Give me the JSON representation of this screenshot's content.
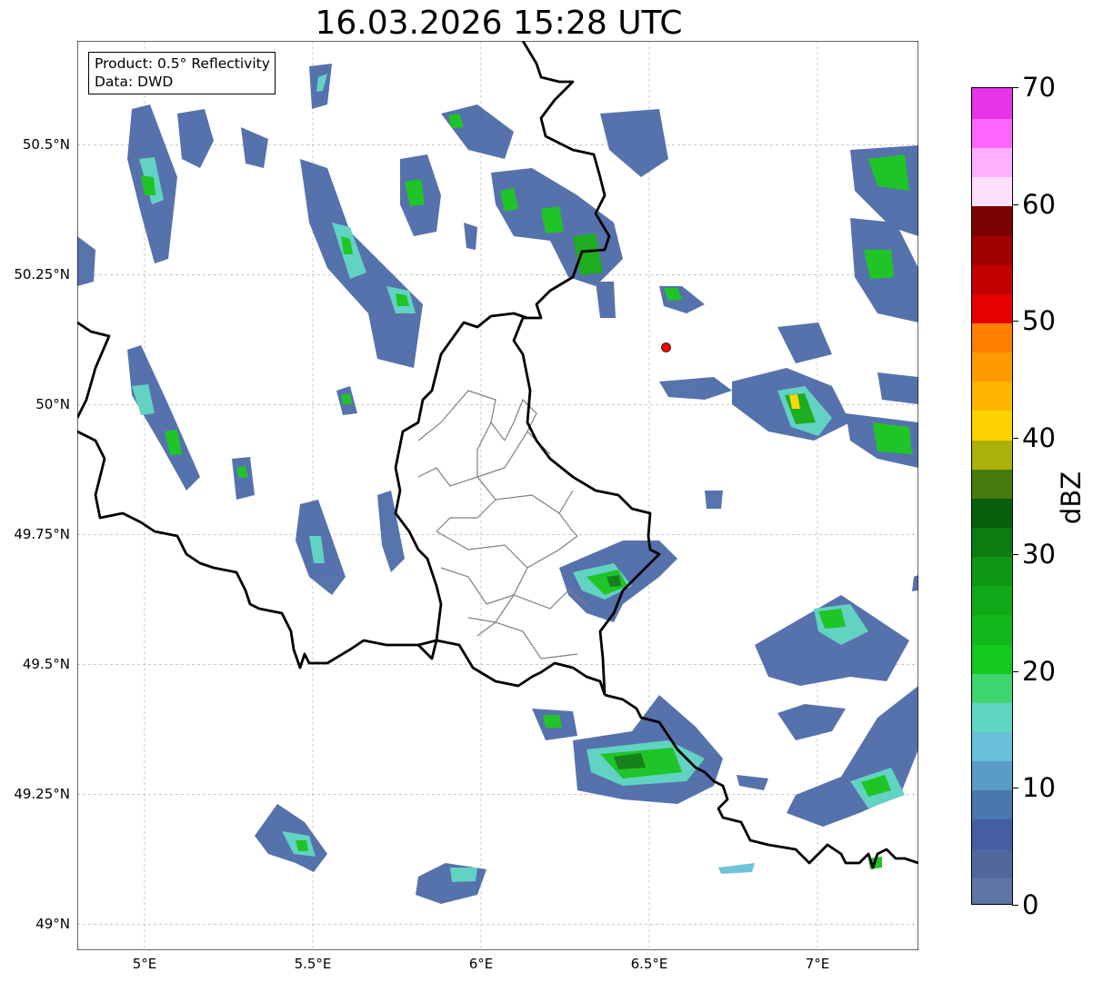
{
  "title": "16.03.2026 15:28 UTC",
  "info": {
    "product_line": "Product: 0.5° Reflectivity",
    "data_line": "Data: DWD"
  },
  "map": {
    "lon_range": [
      4.8,
      7.3
    ],
    "lat_range": [
      48.95,
      50.7
    ],
    "gridlines": true,
    "lat_ticks": [
      {
        "value": 50.5,
        "label": "50.5°N"
      },
      {
        "value": 50.25,
        "label": "50.25°N"
      },
      {
        "value": 50.0,
        "label": "50°N"
      },
      {
        "value": 49.75,
        "label": "49.75°N"
      },
      {
        "value": 49.5,
        "label": "49.5°N"
      },
      {
        "value": 49.25,
        "label": "49.25°N"
      },
      {
        "value": 49.0,
        "label": "49°N"
      }
    ],
    "lon_ticks": [
      {
        "value": 5.0,
        "label": "5°E"
      },
      {
        "value": 5.5,
        "label": "5.5°E"
      },
      {
        "value": 6.0,
        "label": "6°E"
      },
      {
        "value": 6.5,
        "label": "6.5°E"
      },
      {
        "value": 7.0,
        "label": "7°E"
      }
    ],
    "radar_site": {
      "lon": 6.55,
      "lat": 50.11,
      "color": "#ff0000"
    }
  },
  "colorbar": {
    "unit": "dBZ",
    "range": [
      0,
      70
    ],
    "tick_labels": [
      {
        "value": 0,
        "label": "0"
      },
      {
        "value": 10,
        "label": "10"
      },
      {
        "value": 20,
        "label": "20"
      },
      {
        "value": 30,
        "label": "30"
      },
      {
        "value": 40,
        "label": "40"
      },
      {
        "value": 50,
        "label": "50"
      },
      {
        "value": 60,
        "label": "60"
      },
      {
        "value": 70,
        "label": "70"
      }
    ],
    "colors": [
      "#6073a5",
      "#51689f",
      "#445ea1",
      "#4a77b0",
      "#589cc7",
      "#67bfd8",
      "#5ed6c3",
      "#3fd56e",
      "#14c91f",
      "#11b81b",
      "#10a818",
      "#0f9615",
      "#0c7b11",
      "#07600c",
      "#477a0c",
      "#adb10c",
      "#ffd300",
      "#ffb500",
      "#ff9a00",
      "#ff7f00",
      "#e60000",
      "#c20000",
      "#a00000",
      "#7b0000",
      "#ffe0ff",
      "#ffb0ff",
      "#ff66ff",
      "#e933e9"
    ]
  }
}
